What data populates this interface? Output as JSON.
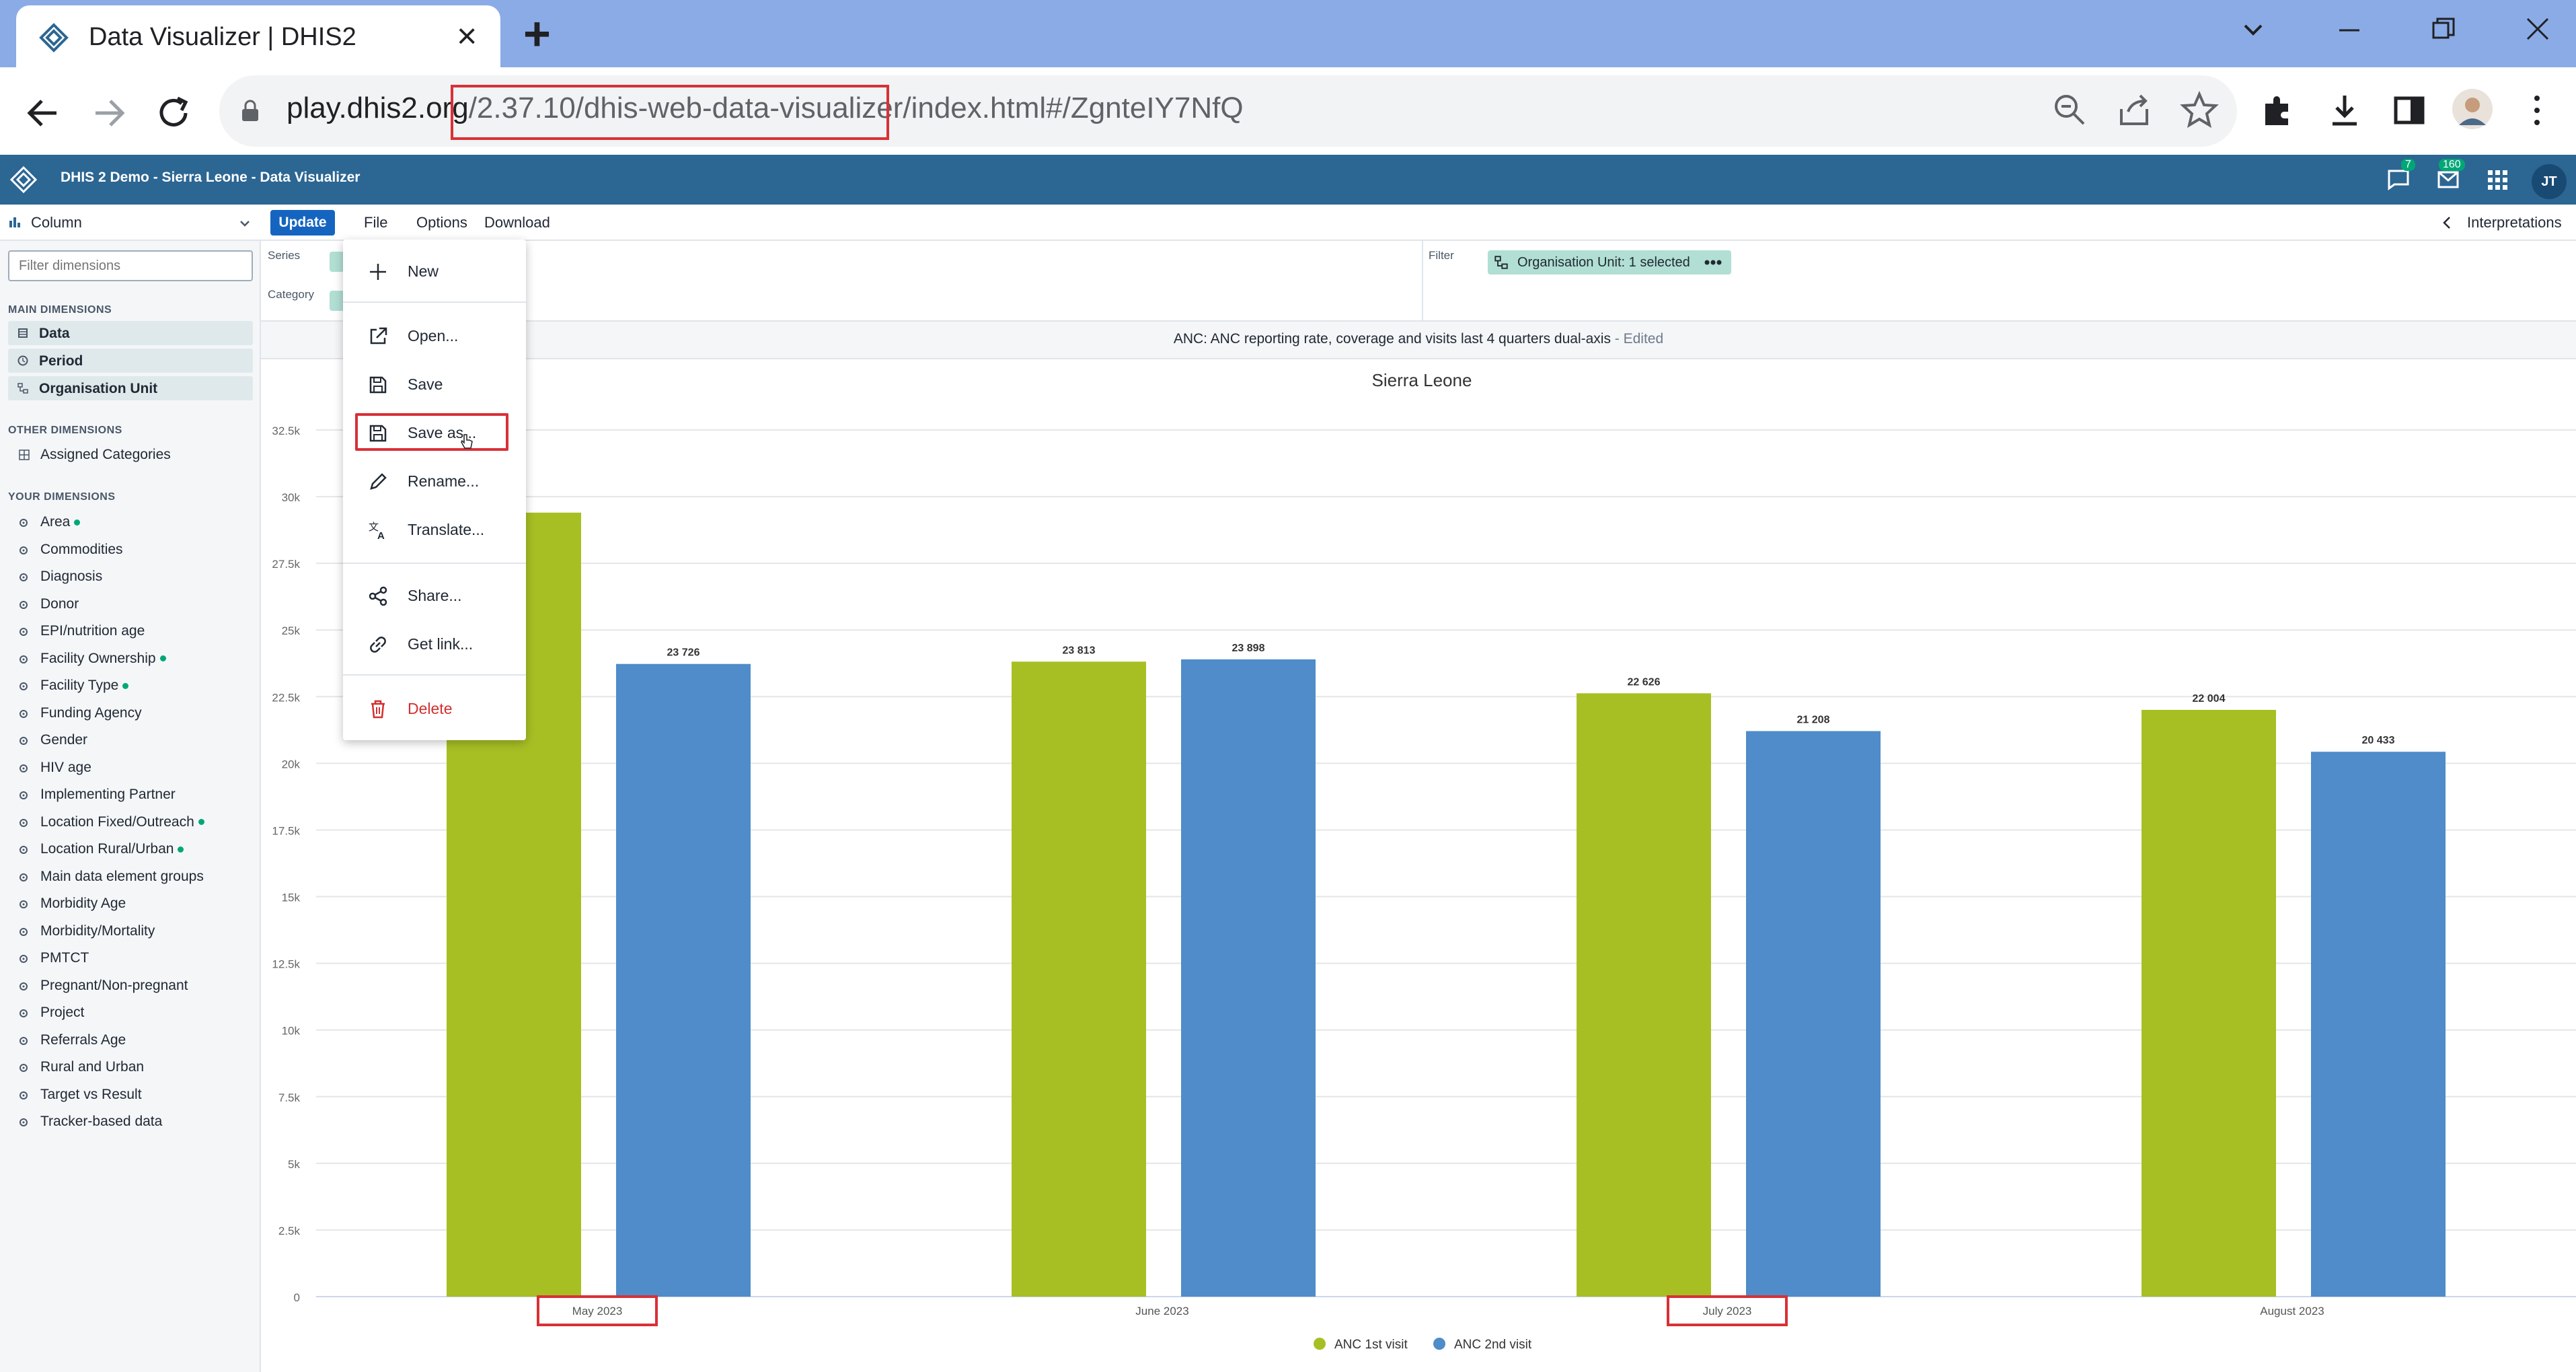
{
  "browser": {
    "tab_title": "Data Visualizer | DHIS2",
    "url_host": "play.dhis2.org",
    "url_path": "/2.37.10/dhis-web-data-visualizer/index.html#/ZgnteIY7NfQ"
  },
  "header": {
    "app_title": "DHIS 2 Demo - Sierra Leone - Data Visualizer",
    "messages_count": "7",
    "interpretations_count": "160",
    "user_initials": "JT"
  },
  "sidebar": {
    "vis_type": "Column",
    "filter_placeholder": "Filter dimensions",
    "main_heading": "MAIN DIMENSIONS",
    "main_items": [
      "Data",
      "Period",
      "Organisation Unit"
    ],
    "other_heading": "OTHER DIMENSIONS",
    "other_items": [
      "Assigned Categories"
    ],
    "your_heading": "YOUR DIMENSIONS",
    "your_items": [
      {
        "label": "Area",
        "active": true
      },
      {
        "label": "Commodities",
        "active": false
      },
      {
        "label": "Diagnosis",
        "active": false
      },
      {
        "label": "Donor",
        "active": false
      },
      {
        "label": "EPI/nutrition age",
        "active": false
      },
      {
        "label": "Facility Ownership",
        "active": true
      },
      {
        "label": "Facility Type",
        "active": true
      },
      {
        "label": "Funding Agency",
        "active": false
      },
      {
        "label": "Gender",
        "active": false
      },
      {
        "label": "HIV age",
        "active": false
      },
      {
        "label": "Implementing Partner",
        "active": false
      },
      {
        "label": "Location Fixed/Outreach",
        "active": true
      },
      {
        "label": "Location Rural/Urban",
        "active": true
      },
      {
        "label": "Main data element groups",
        "active": false
      },
      {
        "label": "Morbidity Age",
        "active": false
      },
      {
        "label": "Morbidity/Mortality",
        "active": false
      },
      {
        "label": "PMTCT",
        "active": false
      },
      {
        "label": "Pregnant/Non-pregnant",
        "active": false
      },
      {
        "label": "Project",
        "active": false
      },
      {
        "label": "Referrals Age",
        "active": false
      },
      {
        "label": "Rural and Urban",
        "active": false
      },
      {
        "label": "Target vs Result",
        "active": false
      },
      {
        "label": "Tracker-based data",
        "active": false
      }
    ]
  },
  "menubar": {
    "update": "Update",
    "file": "File",
    "options": "Options",
    "download": "Download",
    "interpretations": "Interpretations"
  },
  "layout": {
    "series_label": "Series",
    "category_label": "Category",
    "filter_label": "Filter",
    "filter_chip": "Organisation Unit: 1 selected"
  },
  "vis": {
    "title": "ANC: ANC reporting rate, coverage and visits last 4 quarters dual-axis",
    "edited": "- Edited"
  },
  "file_menu": {
    "items": [
      "New",
      "Open...",
      "Save",
      "Save as...",
      "Rename...",
      "Translate...",
      "Share...",
      "Get link...",
      "Delete"
    ]
  },
  "chart_data": {
    "type": "bar",
    "title": "Sierra Leone",
    "categories": [
      "May 2023",
      "June 2023",
      "July 2023",
      "August 2023"
    ],
    "series": [
      {
        "name": "ANC 1st visit",
        "color": "#a8bf24",
        "values": [
          29400,
          23813,
          22626,
          22004
        ],
        "labels": [
          "",
          "23 813",
          "22 626",
          "22 004"
        ]
      },
      {
        "name": "ANC 2nd visit",
        "color": "#4f8cc9",
        "values": [
          23726,
          23898,
          21208,
          20433
        ],
        "labels": [
          "23 726",
          "23 898",
          "21 208",
          "20 433"
        ]
      }
    ],
    "yticks": [
      "0",
      "2.5k",
      "5k",
      "7.5k",
      "10k",
      "12.5k",
      "15k",
      "17.5k",
      "20k",
      "22.5k",
      "25k",
      "27.5k",
      "30k",
      "32.5k"
    ],
    "ylim": [
      0,
      32500
    ],
    "highlighted_categories": [
      "May 2023",
      "July 2023"
    ]
  }
}
